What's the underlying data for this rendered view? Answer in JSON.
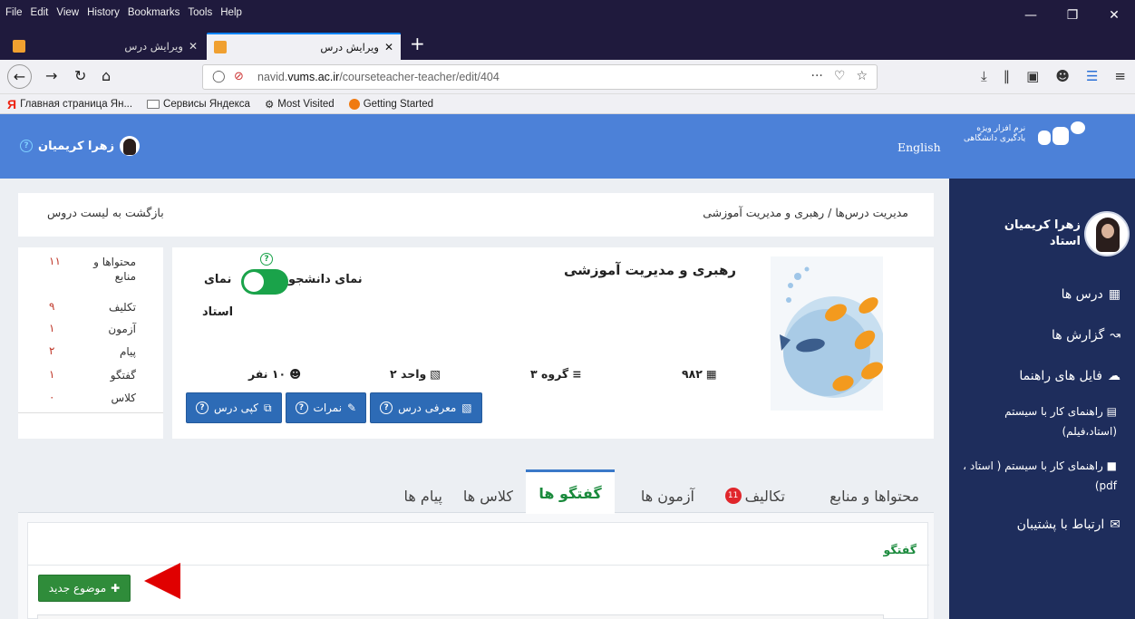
{
  "browser": {
    "menus": [
      "File",
      "Edit",
      "View",
      "History",
      "Bookmarks",
      "Tools",
      "Help"
    ],
    "tabs": [
      {
        "label": "ویرایش درس",
        "active": false
      },
      {
        "label": "ویرایش درس",
        "active": true
      }
    ],
    "url_prefix": "navid.",
    "url_domain": "vums.ac.ir",
    "url_path": "/courseteacher-teacher/edit/404",
    "url_more": "···",
    "bookmarks": [
      "Главная страница Ян...",
      "Сервисы Яндекса",
      "Most Visited",
      "Getting Started"
    ]
  },
  "site": {
    "user_name": "زهرا کریمیان",
    "language_link": "English",
    "logo_line1": "نرم افزار ویژه",
    "logo_line2": "یادگیری دانشگاهی"
  },
  "sidebar": {
    "user_name": "زهرا کریمیان",
    "user_role": "استاد",
    "items": [
      {
        "label": "درس ها",
        "icon": "book-icon"
      },
      {
        "label": "گزارش ها",
        "icon": "chart-icon"
      },
      {
        "label": "فایل های راهنما",
        "icon": "cloud-download-icon"
      }
    ],
    "guide_film": "راهنمای کار با سیستم (استاد،فیلم)",
    "guide_pdf": "راهنمای کار با سیستم ( استاد ، pdf)",
    "support": "ارتباط با پشتیبان"
  },
  "breadcrumb": {
    "text": "مدیریت درس‌ها / رهبری و مدیریت آموزشی",
    "back": "بازگشت به لیست دروس"
  },
  "stats": [
    {
      "label": "محتواها و منابع",
      "value": "۱۱"
    },
    {
      "label": "تکلیف",
      "value": "۹"
    },
    {
      "label": "آزمون",
      "value": "۱"
    },
    {
      "label": "پیام",
      "value": "۲"
    },
    {
      "label": "گفتگو",
      "value": "۱"
    },
    {
      "label": "کلاس",
      "value": "۰"
    }
  ],
  "course": {
    "title": "رهبری و مدیریت آموزشی",
    "toggle_student": "نمای دانشجو",
    "toggle_teacher_1": "نمای",
    "toggle_teacher_2": "استاد",
    "code": "۹۸۲",
    "group": "گروه ۳",
    "units": "واحد ۲",
    "students": "۱۰ نفر",
    "btn_intro": "معرفی درس",
    "btn_grades": "نمرات",
    "btn_copy": "کپی درس"
  },
  "tabs": {
    "items": [
      "محتواها و منابع",
      "تکالیف",
      "آزمون ها",
      "گفتگو ها",
      "کلاس ها",
      "پیام ها"
    ],
    "badge": "11"
  },
  "discussion": {
    "title": "گفتگو",
    "new_topic": "موضوع جدید"
  },
  "colors": {
    "header_blue": "#4c81d8",
    "sidebar_navy": "#1e2d5c",
    "green": "#2f8c3a",
    "annotation_red": "#e00000"
  }
}
